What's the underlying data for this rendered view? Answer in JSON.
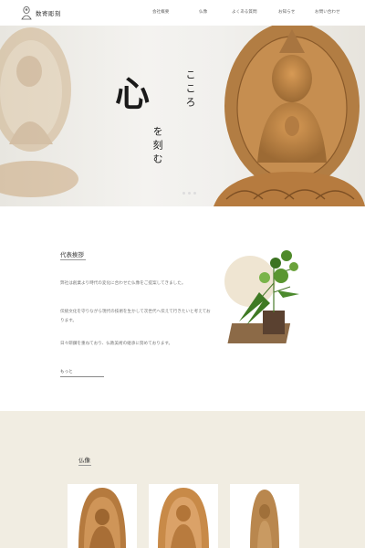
{
  "header": {
    "logo_text": "数寄彫刻",
    "nav": [
      "会社概要",
      "仏像",
      "よくある質問",
      "お知らせ",
      "お問い合わせ"
    ]
  },
  "hero": {
    "kokoro_big": "心",
    "kokoro_kana": "こころ",
    "tagline": "を刻む"
  },
  "greeting": {
    "title": "代表挨拶",
    "paragraphs": [
      "弊社は創業より時代の変化に合わせた仏像をご提案してきました。",
      "伝統文化を守りながら現代の技術を生かして次世代へ伝えて行きたいと考えております。",
      "日々研鑽を重ねており、仏教美術の継承に努めております。"
    ],
    "more": "もっと"
  },
  "butsuzo": {
    "title": "仏像"
  }
}
